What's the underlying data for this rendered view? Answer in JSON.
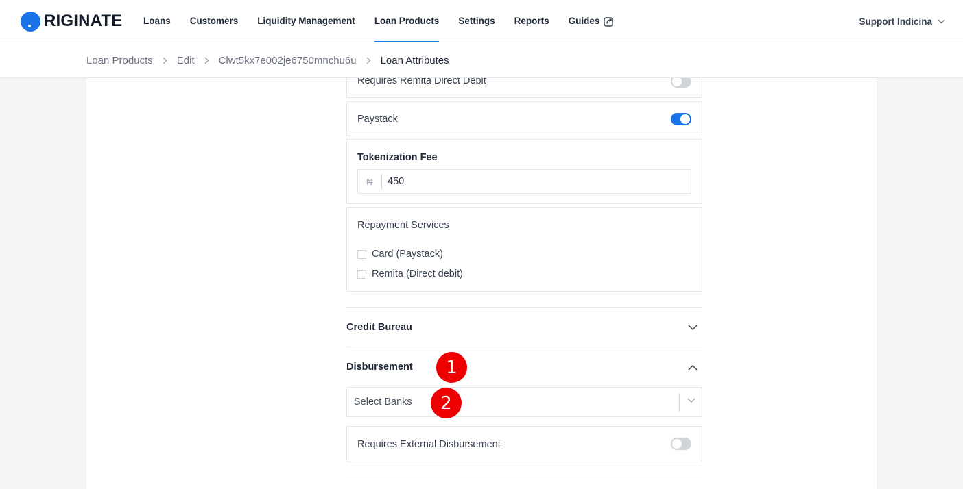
{
  "brand": {
    "name": "RIGINATE",
    "accent": "#1a73e8"
  },
  "nav": {
    "items": [
      {
        "label": "Loans"
      },
      {
        "label": "Customers"
      },
      {
        "label": "Liquidity Management"
      },
      {
        "label": "Loan Products",
        "active": true
      },
      {
        "label": "Settings"
      },
      {
        "label": "Reports"
      },
      {
        "label": "Guides",
        "icon": "external-link-icon"
      }
    ],
    "user": "Support Indicina"
  },
  "breadcrumb": [
    "Loan Products",
    "Edit",
    "Clwt5kx7e002je6750mnchu6u",
    "Loan Attributes"
  ],
  "settings": {
    "remita": {
      "label": "Requires Remita Direct Debit",
      "enabled": false
    },
    "paystack": {
      "label": "Paystack",
      "enabled": true
    },
    "tokenization_fee": {
      "label": "Tokenization Fee",
      "currency": "₦",
      "value": "450"
    },
    "repayment_services": {
      "label": "Repayment Services",
      "options": [
        {
          "label": "Card (Paystack)",
          "checked": false
        },
        {
          "label": "Remita (Direct debit)",
          "checked": false
        }
      ]
    }
  },
  "sections": {
    "credit_bureau": {
      "title": "Credit Bureau",
      "expanded": false
    },
    "disbursement": {
      "title": "Disbursement",
      "expanded": true,
      "select_placeholder": "Select Banks",
      "external": {
        "label": "Requires External Disbursement",
        "enabled": false
      }
    }
  },
  "markers": [
    "1",
    "2"
  ]
}
